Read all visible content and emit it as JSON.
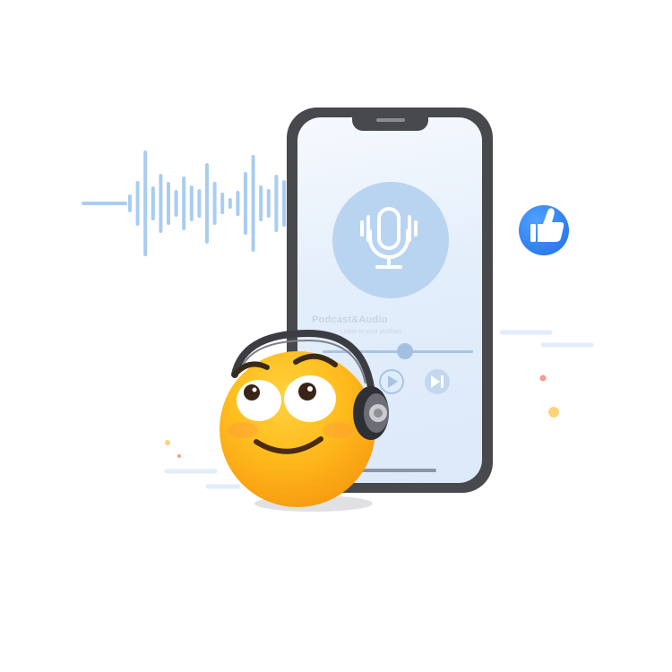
{
  "player": {
    "title": "Podcast&Audio",
    "subtitle": "Listen to your podcast",
    "progress": 0.55
  },
  "icons": {
    "microphone": "microphone-icon",
    "play": "play-icon",
    "next": "skip-next-icon",
    "like": "thumbs-up-icon",
    "waveform": "sound-wave-icon",
    "mascot": "headphone-emoji-icon"
  },
  "colors": {
    "accent_blue": "#1f6fe6",
    "wave_blue": "#a9cdf0",
    "phone_frame": "#48494d",
    "emoji_yellow": "#ffbe1f"
  }
}
